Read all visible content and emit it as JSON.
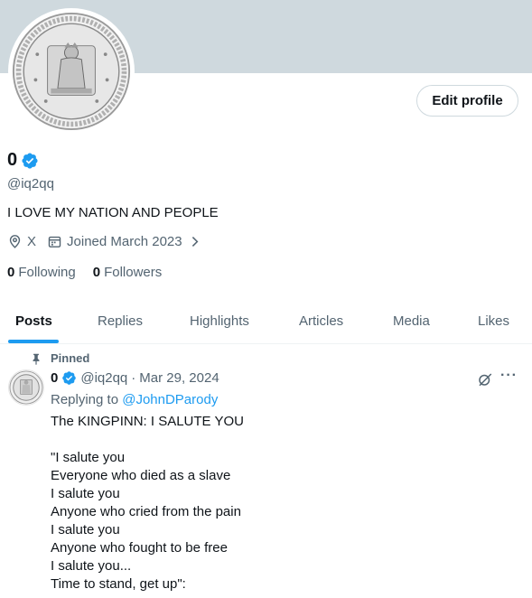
{
  "profile": {
    "edit_profile_label": "Edit profile",
    "display_name": "0",
    "handle": "@iq2qq",
    "bio": "I LOVE MY NATION AND PEOPLE",
    "location": "X",
    "joined": "Joined March 2023",
    "following_count": "0",
    "following_label": "Following",
    "followers_count": "0",
    "followers_label": "Followers",
    "verified_color": "#1d9bf0"
  },
  "tabs": [
    {
      "label": "Posts",
      "active": true
    },
    {
      "label": "Replies"
    },
    {
      "label": "Highlights"
    },
    {
      "label": "Articles"
    },
    {
      "label": "Media"
    },
    {
      "label": "Likes"
    }
  ],
  "post": {
    "pinned_label": "Pinned",
    "author_name": "0",
    "author_handle": "@iq2qq",
    "separator": "·",
    "date": "Mar 29, 2024",
    "replying_prefix": "Replying to",
    "replying_to": "@JohnDParody",
    "text": "The KINGPINN: I SALUTE YOU\n\n\"I salute you\nEveryone who died as a slave\nI salute you\nAnyone who cried from the pain\nI salute you\nAnyone who fought to be free\nI salute you...\nTime to stand, get up\":"
  },
  "icons": {
    "location": "location-pin-icon",
    "calendar": "calendar-icon",
    "chevron": "chevron-right-icon",
    "pin": "pin-icon",
    "grok": "grok-icon",
    "more": "more-icon",
    "verified": "verified-badge-icon"
  }
}
